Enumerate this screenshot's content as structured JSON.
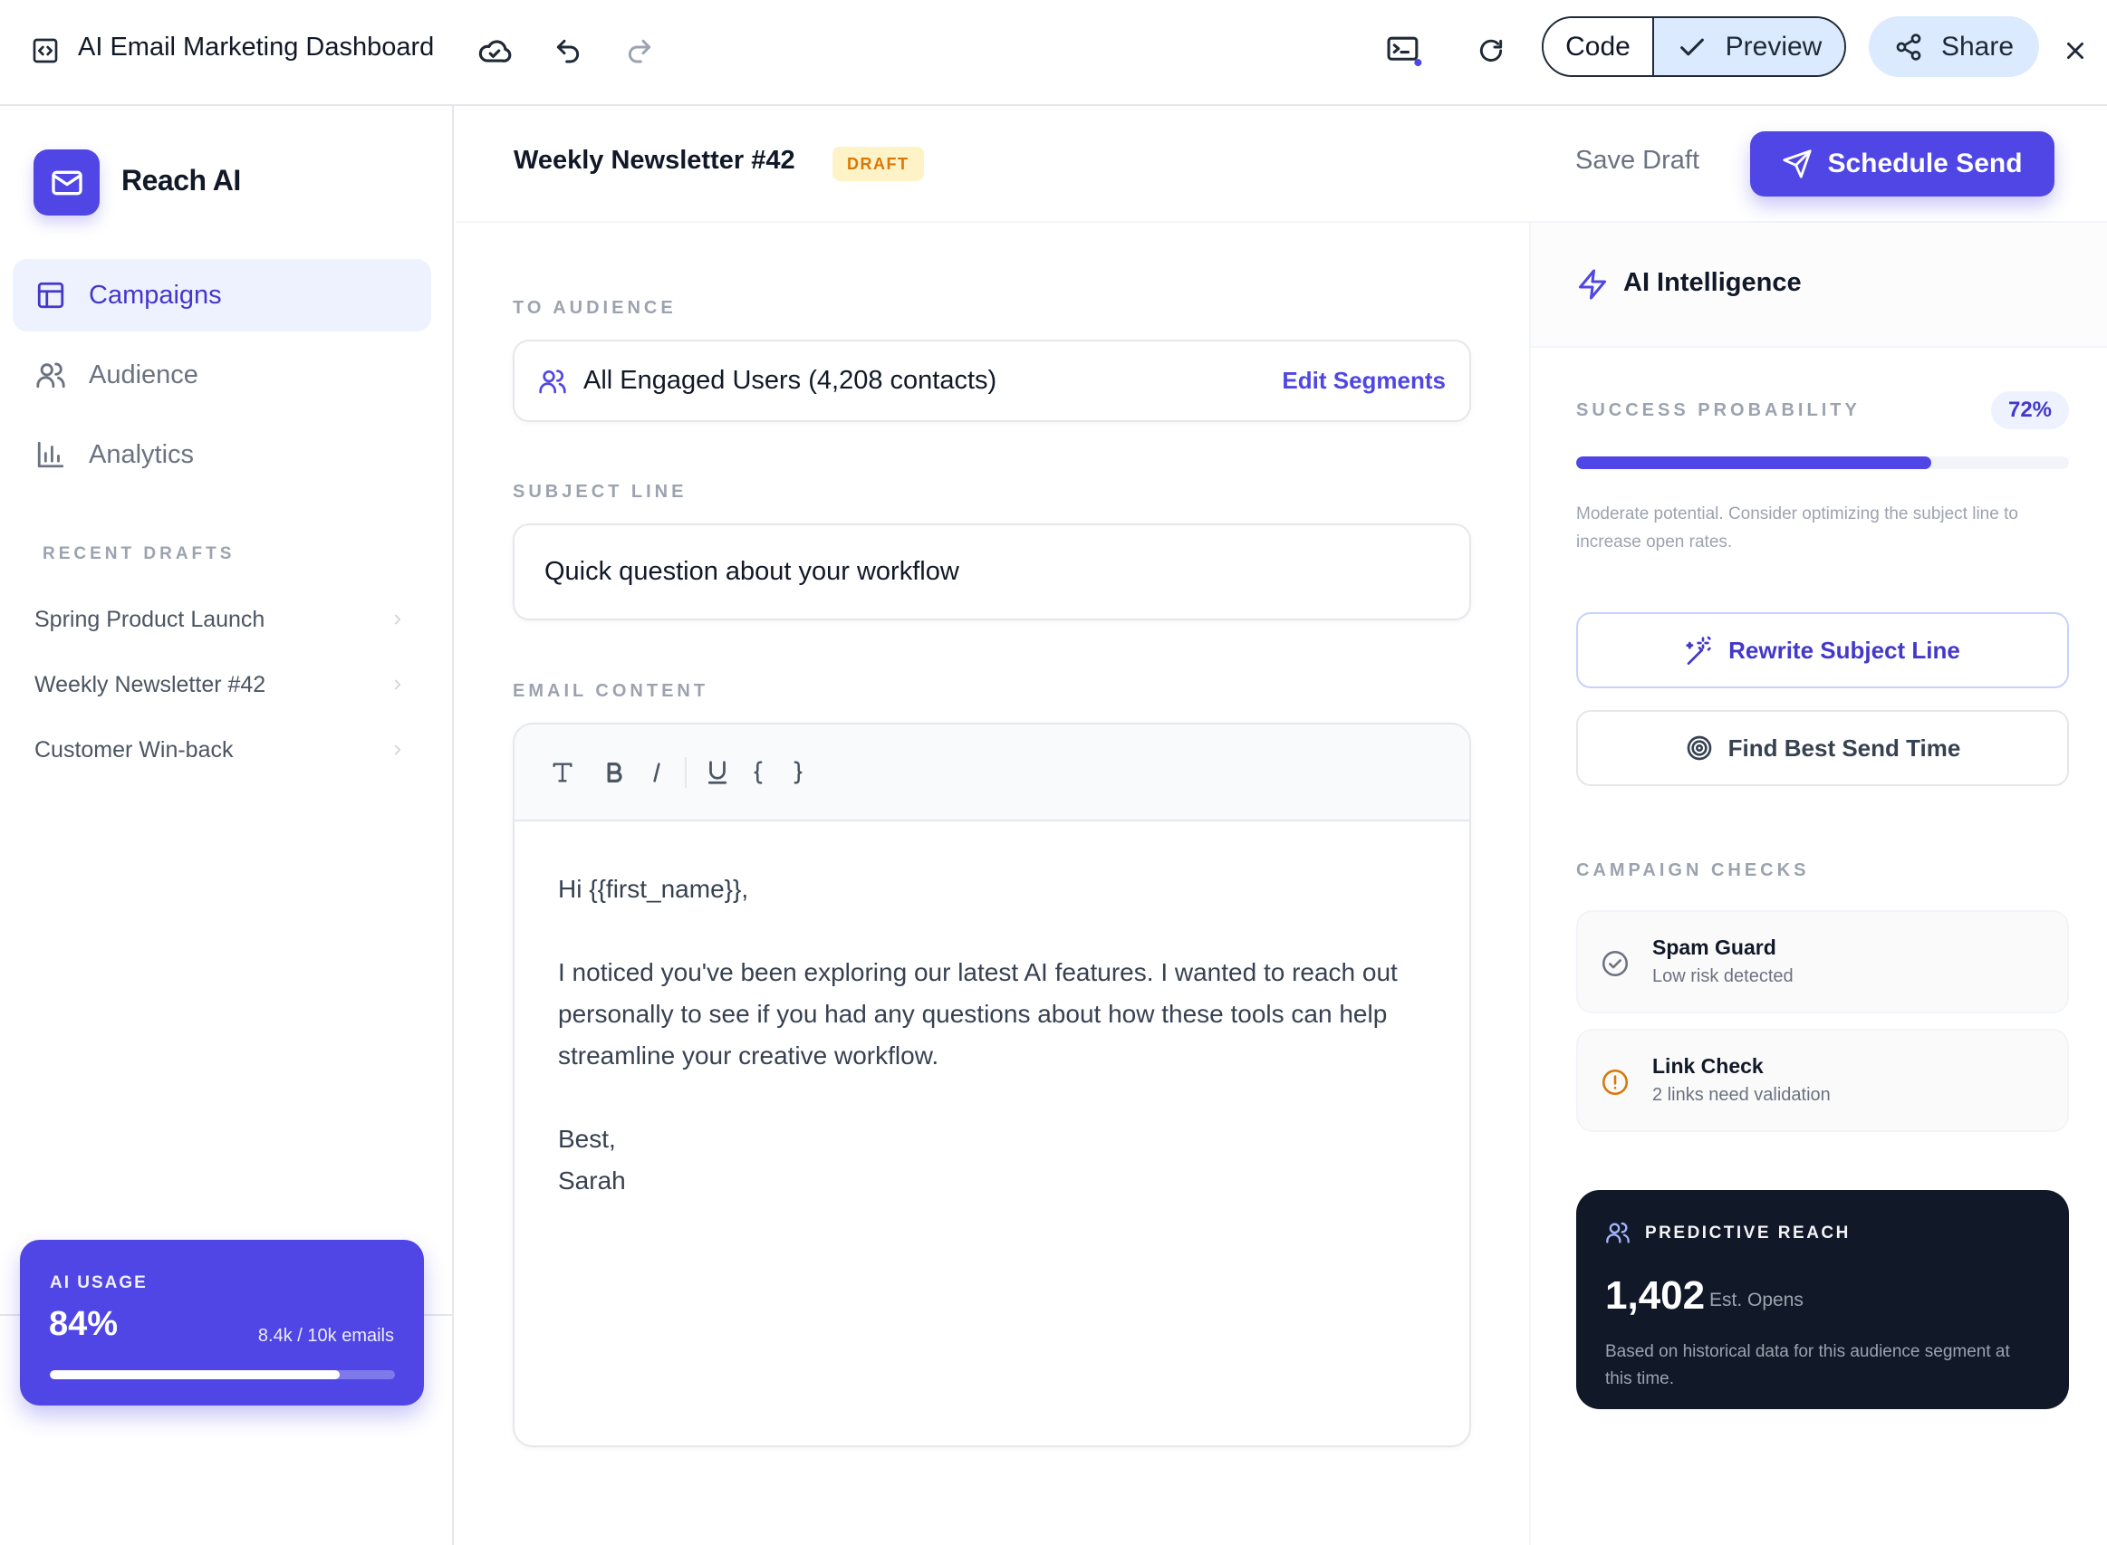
{
  "toolbar": {
    "title": "AI Email Marketing Dashboard",
    "code_label": "Code",
    "preview_label": "Preview",
    "share_label": "Share"
  },
  "sidebar": {
    "brand": "Reach AI",
    "nav": [
      {
        "label": "Campaigns",
        "icon": "layout-icon",
        "active": true
      },
      {
        "label": "Audience",
        "icon": "users-icon",
        "active": false
      },
      {
        "label": "Analytics",
        "icon": "bar-chart-icon",
        "active": false
      }
    ],
    "recent_drafts_label": "RECENT DRAFTS",
    "recent_drafts": [
      {
        "label": "Spring Product Launch"
      },
      {
        "label": "Weekly Newsletter #42"
      },
      {
        "label": "Customer Win-back"
      }
    ],
    "usage": {
      "label": "AI USAGE",
      "percent_text": "84%",
      "percent": 0.84,
      "detail": "8.4k / 10k emails"
    }
  },
  "header": {
    "campaign_title": "Weekly Newsletter #42",
    "status_badge": "DRAFT",
    "save_draft_label": "Save Draft",
    "schedule_label": "Schedule Send"
  },
  "editor": {
    "audience_label": "TO AUDIENCE",
    "audience_value": "All Engaged Users (4,208 contacts)",
    "edit_segments_label": "Edit Segments",
    "subject_label": "SUBJECT LINE",
    "subject_value": "Quick question about your workflow",
    "content_label": "EMAIL CONTENT",
    "body": {
      "greeting": "Hi {{first_name}},",
      "paragraph": "I noticed you've been exploring our latest AI features. I wanted to reach out personally to see if you had any questions about how these tools can help streamline your creative workflow.",
      "signoff": "Best,",
      "signature": "Sarah"
    }
  },
  "ai_panel": {
    "title": "AI Intelligence",
    "success_label": "SUCCESS PROBABILITY",
    "success_text": "72%",
    "success_value": 0.72,
    "success_note": "Moderate potential. Consider optimizing the subject line to increase open rates.",
    "rewrite_label": "Rewrite Subject Line",
    "send_time_label": "Find Best Send Time",
    "checks_label": "CAMPAIGN CHECKS",
    "checks": [
      {
        "title": "Spam Guard",
        "subtitle": "Low risk detected",
        "status": "ok"
      },
      {
        "title": "Link Check",
        "subtitle": "2 links need validation",
        "status": "warning"
      }
    ],
    "reach": {
      "label": "PREDICTIVE REACH",
      "value": "1,402",
      "unit": "Est. Opens",
      "note": "Based on historical data for this audience segment at this time."
    }
  },
  "colors": {
    "accent": "#4f46e5",
    "accent_light": "#eef2ff",
    "warning": "#d97706",
    "dark_card": "#111827"
  }
}
